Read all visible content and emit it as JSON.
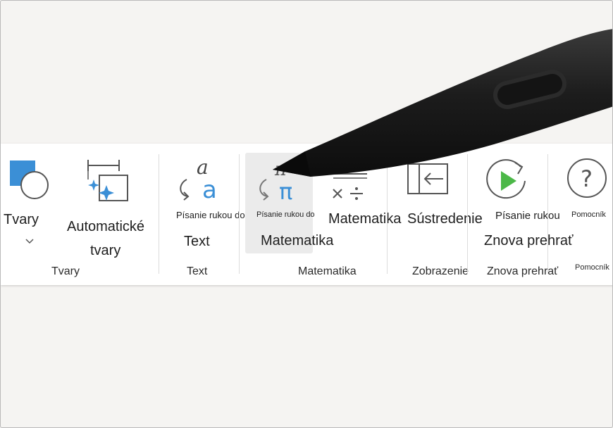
{
  "ribbon": {
    "groups": {
      "tvary": {
        "label": "Tvary",
        "shapes_button": {
          "label": "Tvary",
          "icon": "shapes-icon",
          "dropdown_icon": "chevron-down-icon"
        },
        "auto_shapes_button": {
          "line1": "Automatické",
          "line2": "tvary",
          "icon": "auto-shapes-icon"
        }
      },
      "text": {
        "label": "Text",
        "ink_to_text_button": {
          "caption": "Písanie rukou do",
          "label": "Text",
          "icon": "ink-to-text-icon"
        }
      },
      "matematika": {
        "label": "Matematika",
        "ink_to_math_button": {
          "caption": "Písanie rukou do",
          "label": "Matematika",
          "icon": "ink-to-math-icon"
        },
        "math_button": {
          "label": "Matematika",
          "icon": "math-icon"
        }
      },
      "zobrazenie": {
        "label": "Zobrazenie",
        "focus_button": {
          "label": "Sústredenie",
          "icon": "focus-icon"
        }
      },
      "znova": {
        "label": "Znova prehrať",
        "replay_button": {
          "caption": "Písanie rukou",
          "label": "Znova prehrať",
          "icon": "replay-icon"
        }
      },
      "pomocnik": {
        "label": "Pomocník",
        "help_button": {
          "caption": "Pomocník",
          "icon": "help-icon"
        }
      }
    }
  },
  "colors": {
    "accent_blue": "#3b8fd6",
    "replay_green": "#4cb848",
    "icon_gray": "#555555",
    "pen_body": "#1c1c1c"
  }
}
